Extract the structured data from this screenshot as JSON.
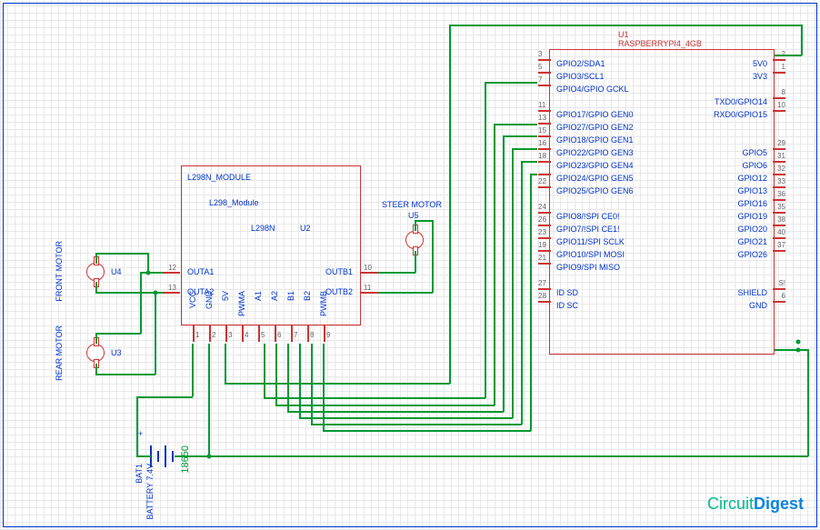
{
  "components": {
    "u1": {
      "ref": "U1",
      "name": "RASPBERRYPI4_4GB"
    },
    "u2": {
      "ref": "U2",
      "name": "L298N_MODULE",
      "part": "L298_Module",
      "chip": "L298N"
    },
    "u3": {
      "ref": "U3",
      "label": "REAR MOTOR"
    },
    "u4": {
      "ref": "U4",
      "label": "FRONT MOTOR"
    },
    "u5": {
      "ref": "U5",
      "label": "STEER MOTOR"
    },
    "bat1": {
      "ref": "BAT1",
      "name": "BATTERY 7.4V",
      "part": "18650"
    }
  },
  "rpi_pins": {
    "left": [
      {
        "num": "3",
        "name": "GPIO2/SDA1"
      },
      {
        "num": "5",
        "name": "GPIO3/SCL1"
      },
      {
        "num": "7",
        "name": "GPIO4/GPIO GCKL"
      },
      {
        "num": "",
        "name": ""
      },
      {
        "num": "11",
        "name": "GPIO17/GPIO GEN0"
      },
      {
        "num": "13",
        "name": "GPIO27/GPIO GEN2"
      },
      {
        "num": "15",
        "name": "GPIO18/GPIO GEN1"
      },
      {
        "num": "16",
        "name": "GPIO22/GPIO GEN3"
      },
      {
        "num": "18",
        "name": "GPIO23/GPIO GEN4"
      },
      {
        "num": "",
        "name": "GPIO24/GPIO GEN5"
      },
      {
        "num": "22",
        "name": "GPIO25/GPIO GEN6"
      },
      {
        "num": "",
        "name": ""
      },
      {
        "num": "24",
        "name": "GPIO8/!SPI CE0!"
      },
      {
        "num": "26",
        "name": "GPIO7/!SPI CE1!"
      },
      {
        "num": "23",
        "name": "GPIO11/SPI SCLK"
      },
      {
        "num": "19",
        "name": "GPIO10/SPI MOSI"
      },
      {
        "num": "21",
        "name": "GPIO9/SPI MISO"
      },
      {
        "num": "",
        "name": ""
      },
      {
        "num": "27",
        "name": "ID SD"
      },
      {
        "num": "28",
        "name": "ID SC"
      }
    ],
    "right": [
      {
        "num": "2",
        "name": "5V0"
      },
      {
        "num": "1",
        "name": "3V3"
      },
      {
        "num": "",
        "name": ""
      },
      {
        "num": "8",
        "name": "TXD0/GPIO14"
      },
      {
        "num": "10",
        "name": "RXD0/GPIO15"
      },
      {
        "num": "",
        "name": ""
      },
      {
        "num": "",
        "name": ""
      },
      {
        "num": "29",
        "name": "GPIO5"
      },
      {
        "num": "31",
        "name": "GPIO6"
      },
      {
        "num": "32",
        "name": "GPIO12"
      },
      {
        "num": "33",
        "name": "GPIO13"
      },
      {
        "num": "36",
        "name": "GPIO16"
      },
      {
        "num": "35",
        "name": "GPIO19"
      },
      {
        "num": "38",
        "name": "GPIO20"
      },
      {
        "num": "40",
        "name": "GPIO21"
      },
      {
        "num": "37",
        "name": "GPIO26"
      },
      {
        "num": "",
        "name": ""
      },
      {
        "num": "",
        "name": ""
      },
      {
        "num": "S!",
        "name": "SHIELD"
      },
      {
        "num": "6",
        "name": "GND"
      }
    ]
  },
  "l298_pins": {
    "left": [
      {
        "num": "12",
        "name": "OUTA1"
      },
      {
        "num": "13",
        "name": "OUTA2"
      }
    ],
    "right": [
      {
        "num": "10",
        "name": "OUTB1"
      },
      {
        "num": "11",
        "name": "OUTB2"
      }
    ],
    "bottom": [
      {
        "num": "1",
        "name": "VCC"
      },
      {
        "num": "2",
        "name": "GND"
      },
      {
        "num": "3",
        "name": "5V"
      },
      {
        "num": "4",
        "name": "PWMA"
      },
      {
        "num": "5",
        "name": "A1"
      },
      {
        "num": "6",
        "name": "A2"
      },
      {
        "num": "7",
        "name": "B1"
      },
      {
        "num": "8",
        "name": "B2"
      },
      {
        "num": "9",
        "name": "PWMB"
      }
    ]
  },
  "logo": {
    "part1": "Circuit",
    "part2": "Digest"
  }
}
